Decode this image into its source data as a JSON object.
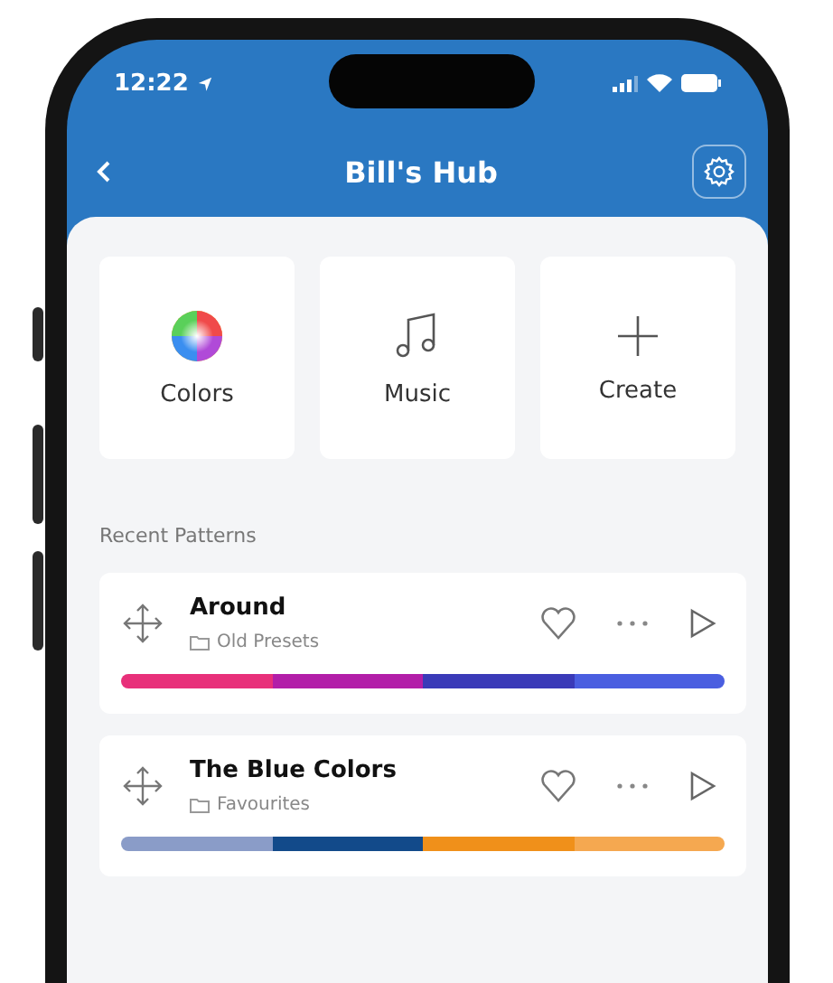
{
  "status_bar": {
    "time": "12:22"
  },
  "header": {
    "title": "Bill's Hub"
  },
  "tiles": [
    {
      "kind": "colors",
      "label": "Colors"
    },
    {
      "kind": "music",
      "label": "Music"
    },
    {
      "kind": "create",
      "label": "Create"
    }
  ],
  "section_title": "Recent Patterns",
  "patterns": [
    {
      "name": "Around",
      "folder": "Old Presets",
      "segments": [
        {
          "color": "#e8307a"
        },
        {
          "color": "#b21ea8"
        },
        {
          "color": "#3a3ab8"
        },
        {
          "color": "#4a5ee0"
        }
      ]
    },
    {
      "name": "The Blue Colors",
      "folder": "Favourites",
      "segments": [
        {
          "color": "#8a9cc8"
        },
        {
          "color": "#124a8a"
        },
        {
          "color": "#f0901a"
        },
        {
          "color": "#f5a850"
        }
      ]
    }
  ]
}
